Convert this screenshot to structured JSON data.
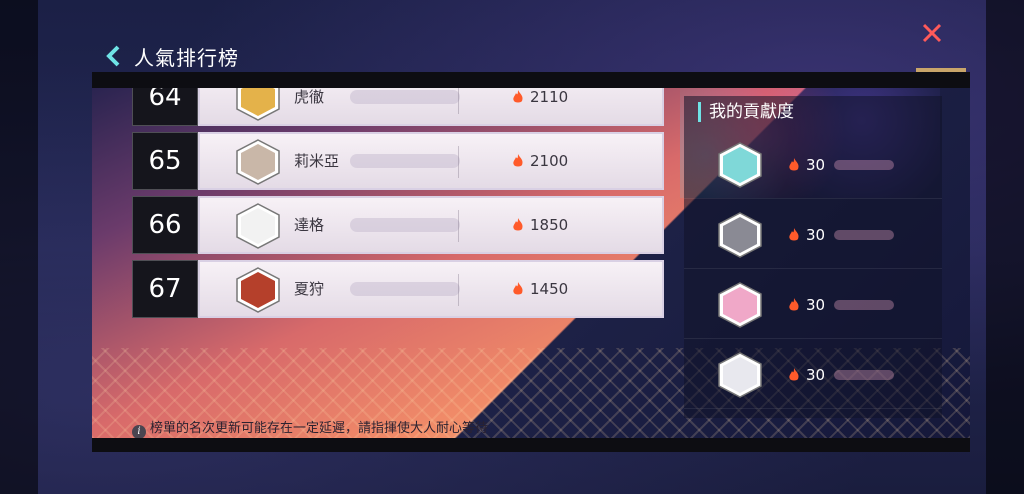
{
  "header": {
    "back_icon": "chevron-left-icon",
    "title": "人氣排行榜",
    "close_icon": "close-icon",
    "accent_color": "#6fe3e6",
    "close_color": "#ff5a5a"
  },
  "ranking": {
    "rows": [
      {
        "rank": "64",
        "name": "虎徹",
        "score": "2110",
        "avatar_color": "#e4b24a"
      },
      {
        "rank": "65",
        "name": "莉米亞",
        "score": "2100",
        "avatar_color": "#c9b7a8"
      },
      {
        "rank": "66",
        "name": "達格",
        "score": "1850",
        "avatar_color": "#f2f2f2"
      },
      {
        "rank": "67",
        "name": "夏狩",
        "score": "1450",
        "avatar_color": "#b5402b"
      }
    ]
  },
  "contribution": {
    "title": "我的貢獻度",
    "rows": [
      {
        "value": "30",
        "avatar_color": "#7fd8d8"
      },
      {
        "value": "30",
        "avatar_color": "#8a8a94"
      },
      {
        "value": "30",
        "avatar_color": "#f0a8c8"
      },
      {
        "value": "30",
        "avatar_color": "#e8e8ee"
      }
    ]
  },
  "notice": {
    "icon": "info-icon",
    "text": "榜單的名次更新可能存在一定延遲，請指揮使大人耐心等待"
  }
}
